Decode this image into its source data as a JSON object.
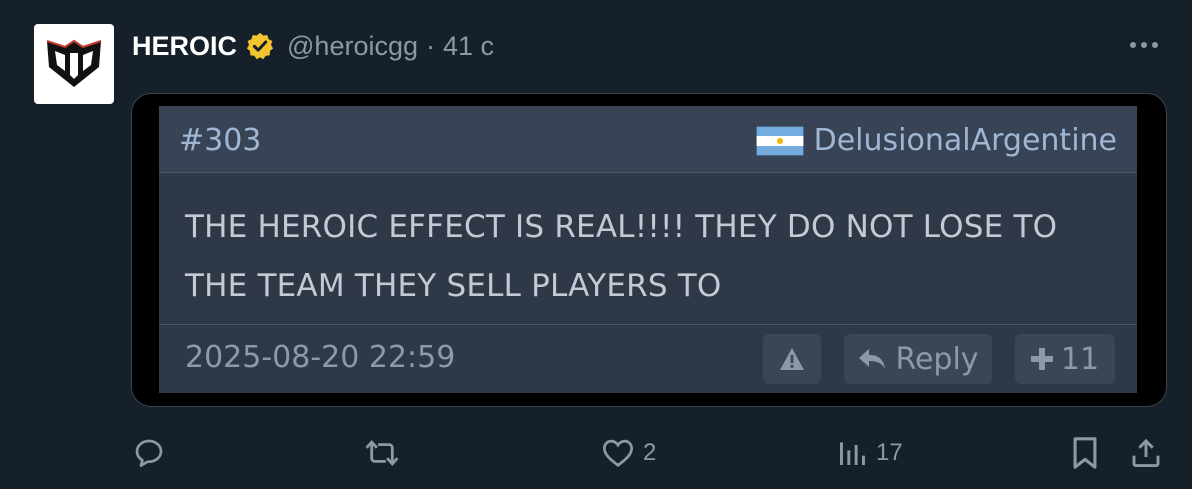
{
  "post": {
    "author_name": "HEROIC",
    "handle": "@heroicgg",
    "separator": "·",
    "time": "41 с",
    "avatar_icon": "heroic-logo",
    "verified_icon": "verified-badge-gold",
    "more_icon": "more-horizontal-icon"
  },
  "embedded": {
    "post_number": "#303",
    "flag_icon": "argentina-flag",
    "author": "DelusionalArgentine",
    "text": "THE HEROIC EFFECT IS REAL!!!! THEY DO NOT LOSE TO THE TEAM THEY SELL PLAYERS TO",
    "date": "2025-08-20 22:59",
    "warn_icon": "warning-icon",
    "reply_label": "Reply",
    "plus_count": "11"
  },
  "actions": {
    "reply_icon": "comment-icon",
    "repost_icon": "repost-icon",
    "like_icon": "heart-icon",
    "like_count": "2",
    "views_icon": "views-chart-icon",
    "views_count": "17",
    "bookmark_icon": "bookmark-icon",
    "share_icon": "share-icon"
  },
  "colors": {
    "background": "#15202b",
    "verified": "#f4c430",
    "muted": "#8b98a5"
  }
}
